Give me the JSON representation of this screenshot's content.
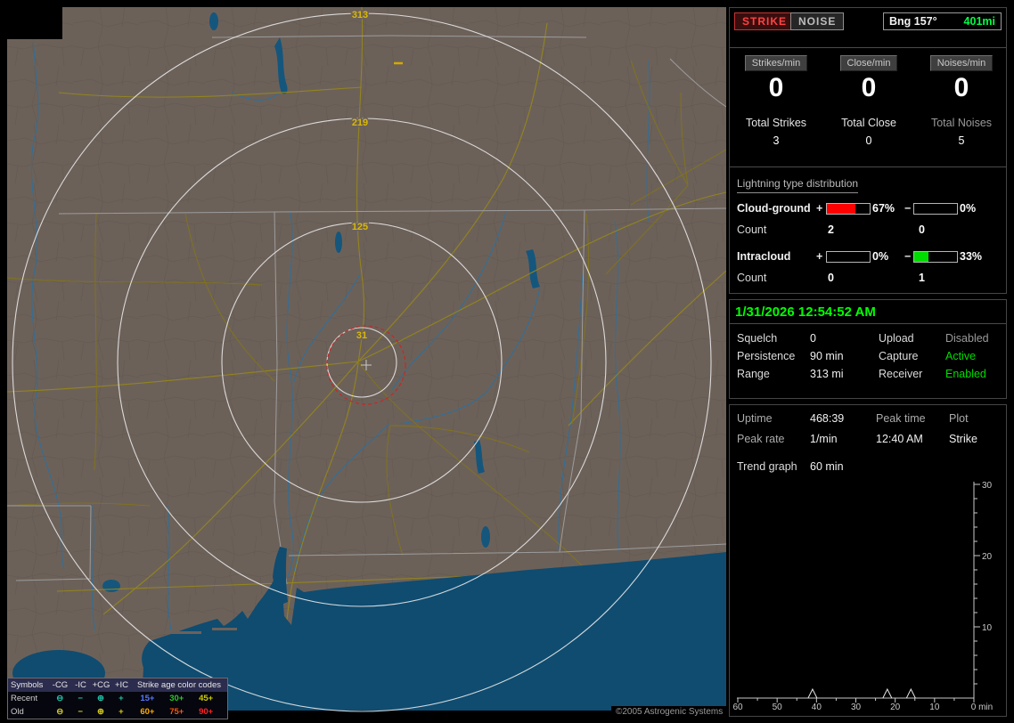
{
  "header": {
    "strike_label": "STRIKE",
    "noise_label": "NOISE",
    "bearing_label": "Bng 157°",
    "range_label": "401mi"
  },
  "rates": {
    "buttons": [
      {
        "label": "Strikes/min",
        "value": "0"
      },
      {
        "label": "Close/min",
        "value": "0"
      },
      {
        "label": "Noises/min",
        "value": "0"
      }
    ],
    "totals": [
      {
        "label": "Total Strikes",
        "value": "3"
      },
      {
        "label": "Total Close",
        "value": "0"
      },
      {
        "label": "Total Noises",
        "value": "5"
      }
    ]
  },
  "distribution": {
    "title": "Lightning type distribution",
    "signs": {
      "plus": "+",
      "minus": "−"
    },
    "count_label": "Count",
    "rows": [
      {
        "label": "Cloud-ground",
        "plus_pct": 67,
        "plus_pct_label": "67%",
        "plus_color": "#ff0000",
        "minus_pct": 0,
        "minus_pct_label": "0%",
        "minus_color": "#00dd00",
        "plus_count": "2",
        "minus_count": "0"
      },
      {
        "label": "Intracloud",
        "plus_pct": 0,
        "plus_pct_label": "0%",
        "plus_color": "#ff0000",
        "minus_pct": 33,
        "minus_pct_label": "33%",
        "minus_color": "#00dd00",
        "plus_count": "0",
        "minus_count": "1"
      }
    ]
  },
  "status": {
    "datetime": "1/31/2026 12:54:52 AM",
    "settings": [
      {
        "label": "Squelch",
        "value": "0",
        "label2": "Upload",
        "value2": "Disabled",
        "value2_color": "#9a9a9a"
      },
      {
        "label": "Persistence",
        "value": "90 min",
        "label2": "Capture",
        "value2": "Active",
        "value2_color": "#00dd00"
      },
      {
        "label": "Range",
        "value": "313 mi",
        "label2": "Receiver",
        "value2": "Enabled",
        "value2_color": "#00dd00"
      }
    ]
  },
  "session": {
    "rows": [
      {
        "c1": "Uptime",
        "c2": "468:39",
        "c3": "Peak time",
        "c4": "Plot"
      },
      {
        "c1": "Peak rate",
        "c2": "1/min",
        "c3": "12:40 AM",
        "c4": "Strike"
      }
    ],
    "trend_label": "Trend graph",
    "trend_window": "60 min"
  },
  "chart_data": {
    "type": "line",
    "title": "Trend graph",
    "window": "60 min",
    "xlabel": "min",
    "x_ticks": [
      60,
      50,
      40,
      30,
      20,
      10,
      0
    ],
    "y_ticks": [
      10,
      20,
      30
    ],
    "ylim": [
      0,
      30
    ],
    "x_direction": "minutes ago, newest at right",
    "series": [
      {
        "name": "Strike rate (strikes/min)",
        "points": [
          {
            "minutes_ago": 41,
            "value": 1
          },
          {
            "minutes_ago": 22,
            "value": 1
          },
          {
            "minutes_ago": 16,
            "value": 1
          }
        ]
      }
    ]
  },
  "map": {
    "rings": [
      {
        "label": "313",
        "radius_mi": 313
      },
      {
        "label": "219",
        "radius_mi": 219
      },
      {
        "label": "125",
        "radius_mi": 125
      },
      {
        "label": "31",
        "radius_mi": 31
      }
    ],
    "alarm_ring_color": "#c62828",
    "legend": {
      "symbols_label": "Symbols",
      "symbol_cols": [
        "-CG",
        "-IC",
        "+CG",
        "+IC"
      ],
      "symbol_glyphs": [
        "⊖",
        "−",
        "⊕",
        "+"
      ],
      "age_title": "Strike age color codes",
      "rows": [
        {
          "label": "Recent",
          "symbol_color": "#21c3a8",
          "ages": [
            {
              "text": "15+",
              "color": "#5577ff"
            },
            {
              "text": "30+",
              "color": "#22cc22"
            },
            {
              "text": "45+",
              "color": "#cccc00"
            }
          ]
        },
        {
          "label": "Old",
          "symbol_color": "#d4cc22",
          "ages": [
            {
              "text": "60+",
              "color": "#ffaa00"
            },
            {
              "text": "75+",
              "color": "#ff5500"
            },
            {
              "text": "90+",
              "color": "#ff2222"
            }
          ]
        }
      ]
    },
    "copyright": "©2005 Astrogenic Systems"
  }
}
